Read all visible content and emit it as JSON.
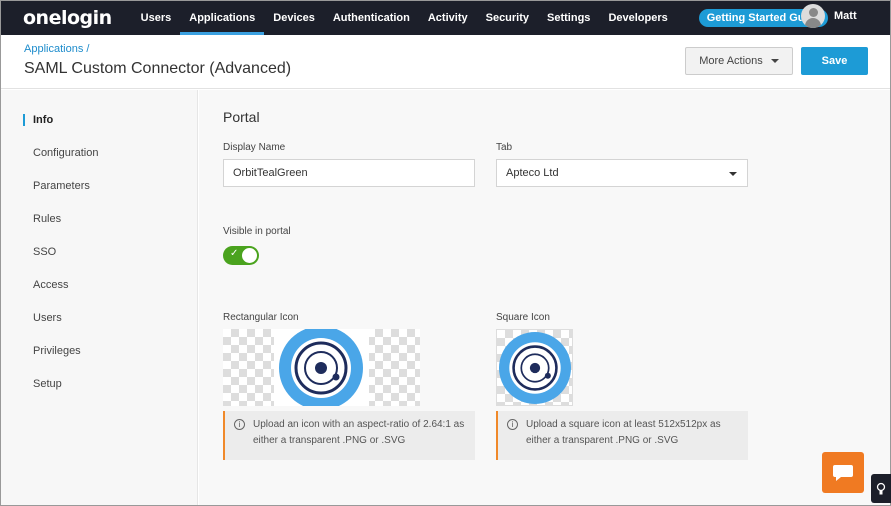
{
  "nav": {
    "logo": "onelogin",
    "items": [
      "Users",
      "Applications",
      "Devices",
      "Authentication",
      "Activity",
      "Security",
      "Settings",
      "Developers"
    ],
    "guide": "Getting Started Guide",
    "user": "Matt"
  },
  "header": {
    "breadcrumb": "Applications /",
    "title": "SAML Custom Connector (Advanced)",
    "more_actions": "More Actions",
    "save": "Save"
  },
  "sidebar": {
    "items": [
      "Info",
      "Configuration",
      "Parameters",
      "Rules",
      "SSO",
      "Access",
      "Users",
      "Privileges",
      "Setup"
    ],
    "active": "Info"
  },
  "portal": {
    "section_title": "Portal",
    "display_name_label": "Display Name",
    "display_name_value": "OrbitTealGreen",
    "tab_label": "Tab",
    "tab_value": "Apteco Ltd",
    "visible_label": "Visible in portal",
    "visible": true,
    "rect_icon_label": "Rectangular Icon",
    "square_icon_label": "Square Icon",
    "rect_info": "Upload an icon with an aspect-ratio of 2.64:1 as either a transparent .PNG or .SVG",
    "square_info": "Upload a square icon at least 512x512px as either a transparent .PNG or .SVG"
  },
  "colors": {
    "accent": "#1d9bd6",
    "nav_bg": "#1c1f2a",
    "toggle_on": "#4aa31e",
    "warning": "#f0892a",
    "chat": "#f07a22",
    "icon_ring": "#4aa6e8",
    "icon_dark": "#1e2c5c"
  },
  "icons": {
    "chat": "chat-bubble-icon",
    "help": "lightbulb-icon"
  }
}
